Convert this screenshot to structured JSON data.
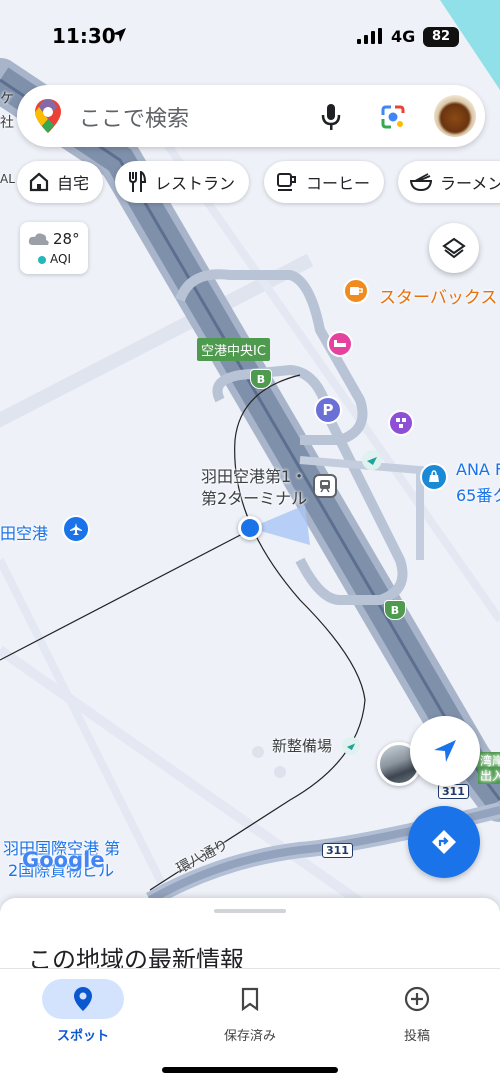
{
  "status": {
    "time": "11:30",
    "network": "4G",
    "battery": "82"
  },
  "search": {
    "placeholder": "ここで検索"
  },
  "chips": [
    {
      "label": "自宅",
      "icon": "home-icon"
    },
    {
      "label": "レストラン",
      "icon": "restaurant-icon"
    },
    {
      "label": "コーヒー",
      "icon": "coffee-icon"
    },
    {
      "label": "ラーメン",
      "icon": "ramen-icon"
    }
  ],
  "weather": {
    "temp": "28°",
    "aqi": "AQI"
  },
  "map": {
    "starbucks": "スターバックス",
    "airport_ic": "空港中央IC",
    "terminal_line1": "羽田空港第1・",
    "terminal_line2": "第2ターミナル",
    "ana": "ANA F",
    "ana2": "65番ク",
    "airport_left": "田空港",
    "seibi": "新整備場",
    "intl_line1": "羽田国際空港 第",
    "intl_line2": "2国際貨物ビル",
    "kanpachi": "環八通り",
    "route311a": "311",
    "route311b": "311",
    "b_label": "B",
    "p_label": "P",
    "topleft1": "ケ",
    "topleft2": "社",
    "topleft3": "AL",
    "right_exit1": "湾岸環",
    "right_exit2": "出入",
    "google": "Google"
  },
  "sheet": {
    "title": "この地域の最新情報"
  },
  "nav": [
    {
      "label": "スポット",
      "active": true
    },
    {
      "label": "保存済み",
      "active": false
    },
    {
      "label": "投稿",
      "active": false
    }
  ],
  "colors": {
    "accent": "#1a73e8",
    "starbucks": "#e8710a",
    "route_green": "#4e9a4e"
  }
}
